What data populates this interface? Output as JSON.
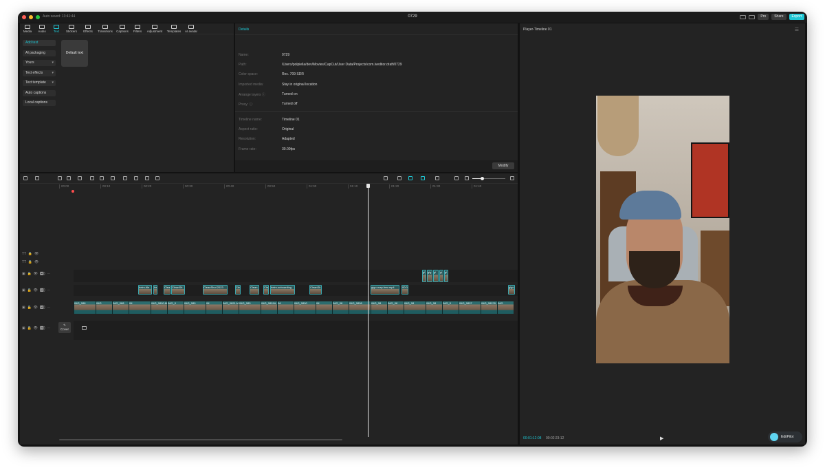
{
  "titlebar": {
    "autosave": "Auto saved: 13:41:44",
    "title": "0729",
    "pro_label": "Pro",
    "share_label": "Share",
    "export_label": "Export"
  },
  "tools": [
    {
      "label": "Media",
      "icon": "media-icon"
    },
    {
      "label": "Audio",
      "icon": "audio-icon"
    },
    {
      "label": "Text",
      "icon": "text-icon"
    },
    {
      "label": "Stickers",
      "icon": "sticker-icon"
    },
    {
      "label": "Effects",
      "icon": "effects-icon"
    },
    {
      "label": "Transitions",
      "icon": "transitions-icon"
    },
    {
      "label": "Captions",
      "icon": "captions-icon"
    },
    {
      "label": "Filters",
      "icon": "filters-icon"
    },
    {
      "label": "Adjustment",
      "icon": "adjustment-icon"
    },
    {
      "label": "Templates",
      "icon": "templates-icon"
    },
    {
      "label": "AI avatar",
      "icon": "ai-avatar-icon"
    }
  ],
  "sidebar": [
    {
      "label": "Add text"
    },
    {
      "label": "AI packaging"
    },
    {
      "label": "Yours"
    },
    {
      "label": "Text effects"
    },
    {
      "label": "Text template"
    },
    {
      "label": "Auto captions"
    },
    {
      "label": "Local captions"
    }
  ],
  "tile_label": "Default text",
  "details": {
    "title": "Details",
    "rows": [
      {
        "label": "Name:",
        "value": "0729"
      },
      {
        "label": "Path:",
        "value": "/Users/polpiella/dev/Movies/CapCut/User Data/Projects/com.lveditor.draft/0729"
      },
      {
        "label": "Color space:",
        "value": "Rec. 709 SDR"
      },
      {
        "label": "Imported media:",
        "value": "Stay in original location"
      },
      {
        "label": "Arrange layers ⓘ",
        "value": "Turned on"
      },
      {
        "label": "Proxy: ⓘ",
        "value": "Turned off"
      },
      {
        "label": "Timeline name:",
        "value": "Timeline 01"
      },
      {
        "label": "Aspect ratio:",
        "value": "Original"
      },
      {
        "label": "Resolution:",
        "value": "Adapted"
      },
      {
        "label": "Frame rate:",
        "value": "30.00fps"
      }
    ],
    "modify_label": "Modify"
  },
  "player": {
    "title": "Player-Timeline 01",
    "current_time": "00:01:12:08",
    "total_time": "00:02:23:12",
    "editpilot_label": "EditPilot"
  },
  "timeline": {
    "ruler": [
      "00:00",
      "00:10",
      "00:20",
      "00:30",
      "00:40",
      "00:50",
      "01:00",
      "01:10",
      "01:20",
      "01:30",
      "01:40"
    ],
    "cover_label": "Cover",
    "zoom_level": 0.3,
    "text_clips": [
      "helm-tile",
      "hel",
      "Clea",
      "CleanSh",
      "CleanShot 2023",
      "Cle",
      "Clean",
      "Cle",
      "helm-onboarding",
      "CleanSh",
      "gigo-map-fear.mp4",
      "00:0",
      "gigo"
    ],
    "video_clips": [
      "IMG_088",
      "IMG",
      "IMG_088",
      "IM",
      "IMG_0890.M",
      "IMG_0",
      "IMG_089",
      "IM",
      "IMG_0891.MOV",
      "IMG_089",
      "IMG_0891A",
      "IM",
      "IMG_0890",
      "IM",
      "IMG_08",
      "IMG_0896",
      "IMG_08",
      "IMG_08",
      "IMG_08",
      "IMG_08",
      "IMG_0",
      "IMG_0897",
      "IMG_08978",
      "IMG"
    ]
  }
}
